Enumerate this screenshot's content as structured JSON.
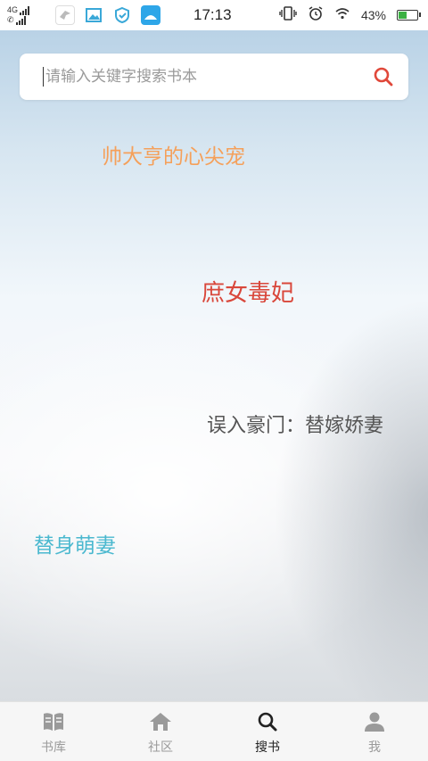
{
  "status_bar": {
    "network_top": "4G",
    "time": "17:13",
    "battery_percent": "43%",
    "battery_level": 0.43,
    "app_icons": [
      "bird-app-icon",
      "gallery-icon",
      "shield-check-icon",
      "blue-app-icon"
    ]
  },
  "search": {
    "placeholder": "请输入关键字搜索书本",
    "icon": "search-icon",
    "icon_color": "#e0483a"
  },
  "keywords": [
    {
      "text": "帅大亨的心尖宠",
      "color": "#f5a05a"
    },
    {
      "text": "庶女毒妃",
      "color": "#d9473b"
    },
    {
      "text": "误入豪门：替嫁娇妻",
      "color": "#555555"
    },
    {
      "text": "替身萌妻",
      "color": "#4ab8cf"
    }
  ],
  "tabs": [
    {
      "label": "书库",
      "icon": "book-icon",
      "active": false
    },
    {
      "label": "社区",
      "icon": "home-icon",
      "active": false
    },
    {
      "label": "搜书",
      "icon": "search-icon",
      "active": true
    },
    {
      "label": "我",
      "icon": "user-icon",
      "active": false
    }
  ],
  "colors": {
    "tab_active": "#222222",
    "tab_inactive": "#9a9a9a"
  }
}
